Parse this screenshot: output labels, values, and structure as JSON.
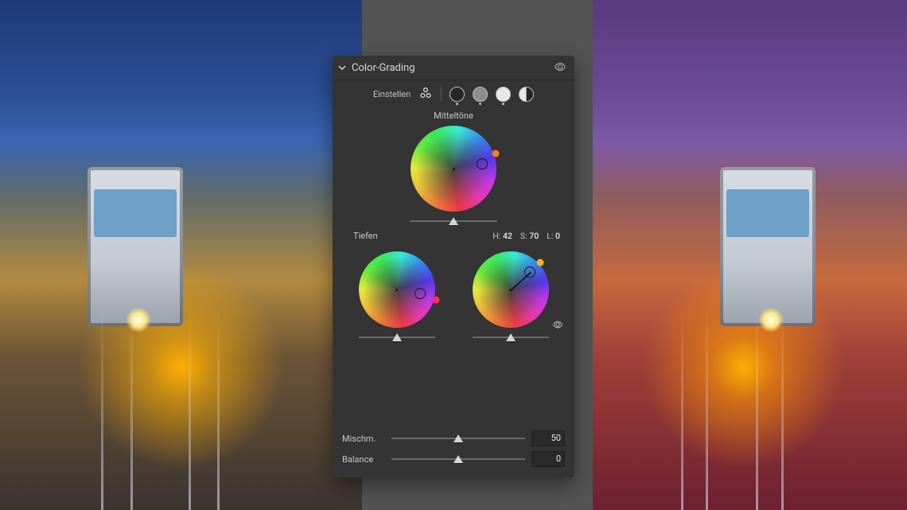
{
  "panel": {
    "title": "Color-Grading",
    "adjust_label": "Einstellen",
    "midtones": {
      "title": "Mitteltöne",
      "ring": {
        "hue": 10,
        "sat": 68
      },
      "chip": {
        "hue": 20,
        "color": "#ff7a1a"
      },
      "luminance": 50
    },
    "shadows": {
      "title": "Tiefen",
      "ring": {
        "hue": 350,
        "sat": 62
      },
      "chip": {
        "hue": 345,
        "color": "#ff2a6a"
      },
      "luminance": 50
    },
    "highlights": {
      "ring": {
        "hue": 42,
        "sat": 70
      },
      "chip": {
        "hue": 42,
        "color": "#ffb020"
      },
      "luminance": 50,
      "readout_h_label": "H:",
      "readout_s_label": "S:",
      "readout_l_label": "L:",
      "readout_h": "42",
      "readout_s": "70",
      "readout_l": "0"
    },
    "blend": {
      "label": "Mischm.",
      "value": "50",
      "pos": 50
    },
    "balance": {
      "label": "Balance",
      "value": "0",
      "pos": 50
    }
  }
}
